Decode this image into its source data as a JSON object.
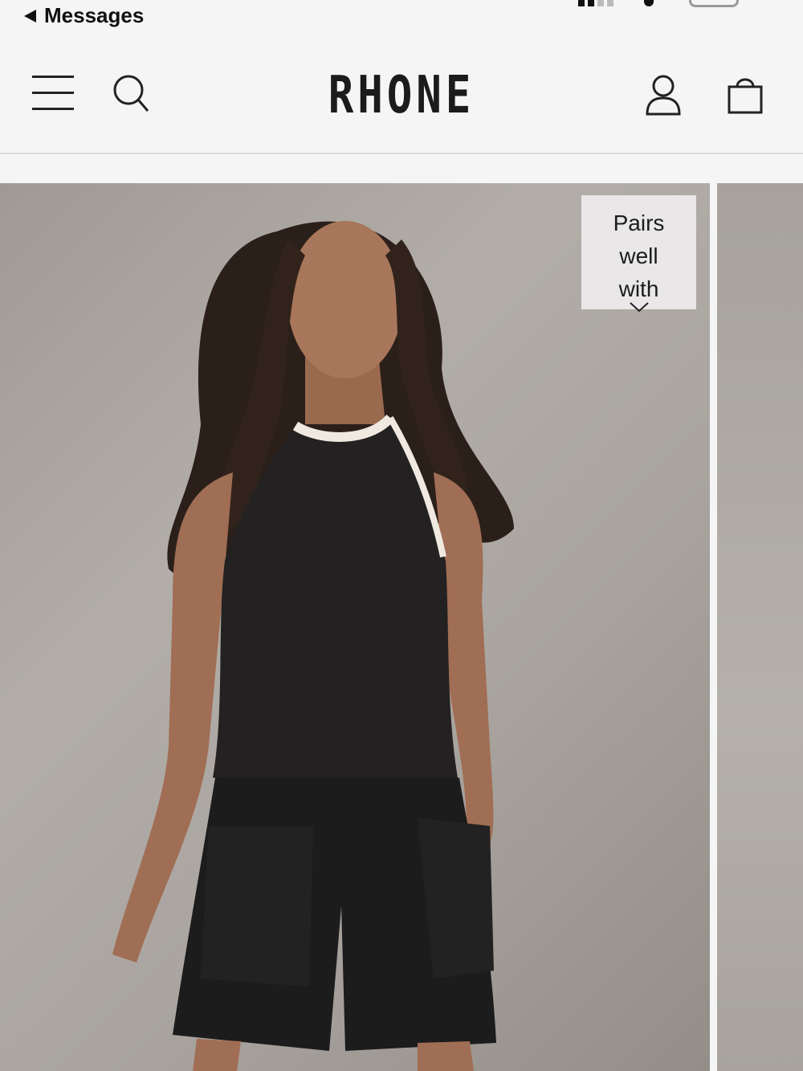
{
  "status_bar": {
    "back_label": "Messages"
  },
  "header": {
    "logo": "RHONE",
    "menu_icon": "hamburger-menu-icon",
    "search_icon": "search-icon",
    "account_icon": "user-account-icon",
    "bag_icon": "shopping-bag-icon"
  },
  "product": {
    "image_alt": "Model wearing black halter top with white trim and black shorts",
    "pairs_badge_label": "Pairs well with",
    "pairs_badge_icon": "chevron-down-icon"
  },
  "colors": {
    "background": "#f6f5f6",
    "text": "#1b1b1b",
    "badge_bg": "#e9e7e8",
    "divider": "#dcdadb"
  }
}
